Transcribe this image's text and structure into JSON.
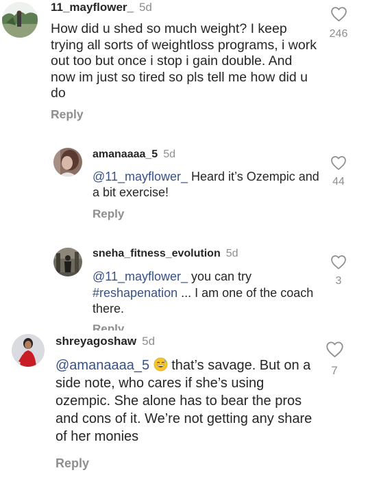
{
  "comments": [
    {
      "username": "11_mayflower_",
      "time": "5d",
      "text": "How did u shed so much weight? I keep trying all sorts of weightloss programs, i work out too but once i stop i gain double. And now im just so tired so pls tell me how did u do",
      "reply_label": "Reply",
      "likes": "246"
    },
    {
      "username": "amanaaaa_5",
      "time": "5d",
      "mention": "@11_mayflower_",
      "text": " Heard it’s Ozempic and a bit exercise!",
      "reply_label": "Reply",
      "likes": "44"
    },
    {
      "username": "sneha_fitness_evolution",
      "time": "5d",
      "mention": "@11_mayflower_",
      "text_a": " you can try ",
      "hashtag": "#reshapenation",
      "text_b": " ... I am one of the coach there.",
      "reply_label": "Reply",
      "likes": "3"
    },
    {
      "username": "shreyagoshaw",
      "time": "5d",
      "mention": "@amanaaaa_5",
      "emoji": "grinning-sweat-emoji",
      "text": " that’s savage. But on a side note, who cares if she’s using ozempic. She alone has to bear the pros and cons of it. We’re not getting any share of her monies",
      "reply_label": "Reply",
      "likes": "7"
    }
  ],
  "icons": {
    "like": "heart-outline-icon"
  },
  "colors": {
    "text": "#262626",
    "muted": "#8e8e8e",
    "link": "#385185"
  }
}
